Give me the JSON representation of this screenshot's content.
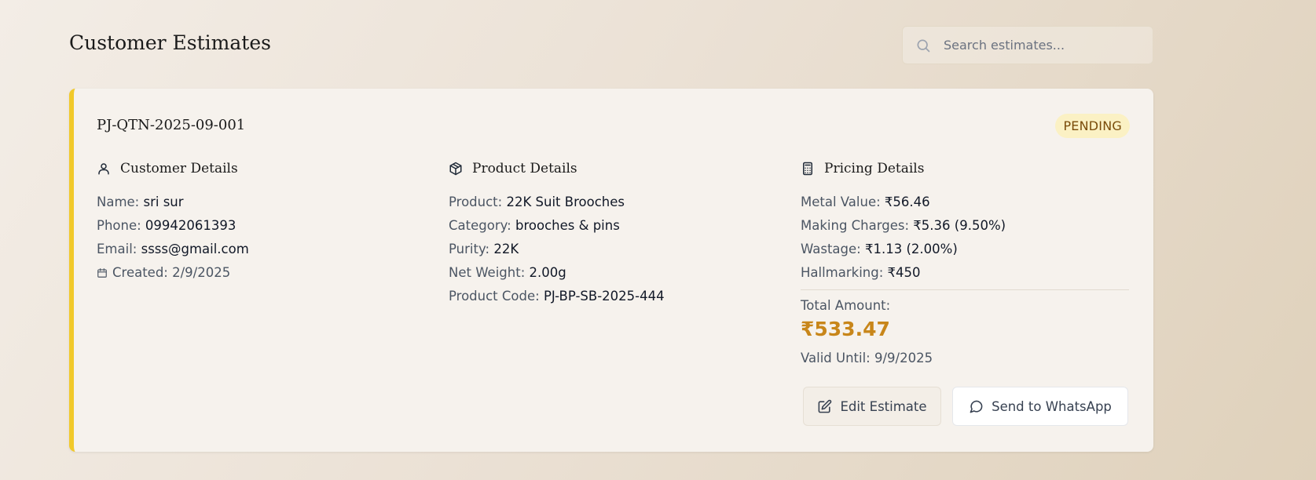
{
  "header": {
    "title": "Customer Estimates",
    "search_placeholder": "Search estimates..."
  },
  "estimate": {
    "id": "PJ-QTN-2025-09-001",
    "status": "PENDING",
    "accent_color": "#f1c92a",
    "customer": {
      "heading": "Customer Details",
      "name_label": "Name:",
      "name": "sri sur",
      "phone_label": "Phone:",
      "phone": "09942061393",
      "email_label": "Email:",
      "email": "ssss@gmail.com",
      "created": "Created: 2/9/2025"
    },
    "product": {
      "heading": "Product Details",
      "product_label": "Product:",
      "product": "22K Suit Brooches",
      "category_label": "Category:",
      "category": "brooches & pins",
      "purity_label": "Purity:",
      "purity": "22K",
      "net_weight_label": "Net Weight:",
      "net_weight": "2.00g",
      "code_label": "Product Code:",
      "code": "PJ-BP-SB-2025-444"
    },
    "pricing": {
      "heading": "Pricing Details",
      "metal_value_label": "Metal Value:",
      "metal_value": "₹56.46",
      "making_label": "Making Charges:",
      "making": "₹5.36 (9.50%)",
      "wastage_label": "Wastage:",
      "wastage": "₹1.13 (2.00%)",
      "hallmarking_label": "Hallmarking:",
      "hallmarking": "₹450",
      "total_label": "Total Amount:",
      "total": "₹533.47",
      "total_color": "#c8861a",
      "valid_until": "Valid Until: 9/9/2025"
    },
    "actions": {
      "edit_label": "Edit Estimate",
      "whatsapp_label": "Send to WhatsApp"
    }
  },
  "icons": {
    "search": "search-icon",
    "customer": "user-icon",
    "product": "package-icon",
    "pricing": "calculator-icon",
    "created": "calendar-icon",
    "edit": "edit-icon",
    "whatsapp": "message-circle-icon"
  }
}
